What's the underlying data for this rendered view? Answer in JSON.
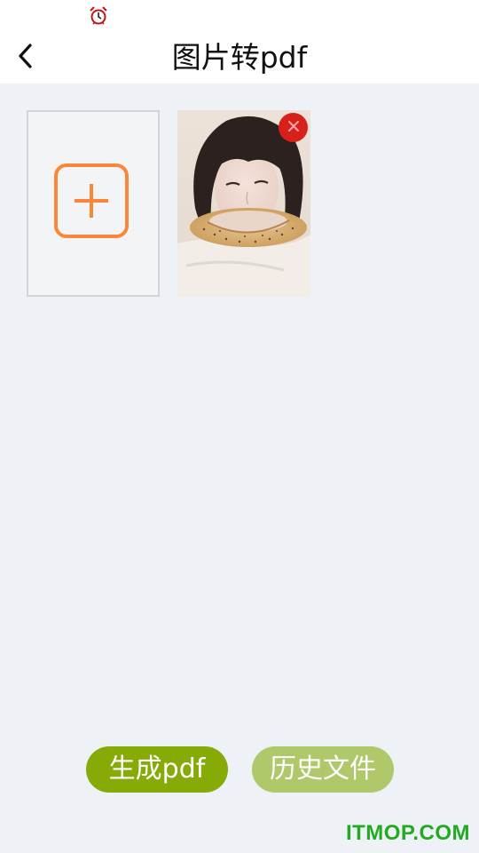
{
  "status_bar": {
    "alarm_icon": "alarm-clock-icon"
  },
  "header": {
    "back_icon": "chevron-left-icon",
    "title": "图片转pdf"
  },
  "gallery": {
    "add_icon": "plus-icon",
    "photos": [
      {
        "remove_icon": "close-icon"
      }
    ]
  },
  "actions": {
    "generate_label": "生成pdf",
    "history_label": "历史文件"
  },
  "watermark": "ITMOP.COM",
  "colors": {
    "accent_orange": "#fb8538",
    "generate_green": "#86aa06",
    "history_green": "#afc86a",
    "remove_red": "#d7201c",
    "background": "#eef1f5"
  }
}
